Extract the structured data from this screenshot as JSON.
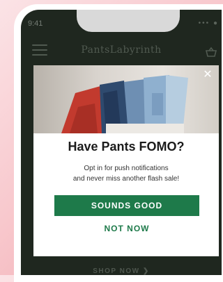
{
  "status_bar": {
    "time": "9:41",
    "icons": "••• ●"
  },
  "nav": {
    "brand": "PantsLabyrinth"
  },
  "background": {
    "shop_link": "SHOP NOW ❯"
  },
  "modal": {
    "close_glyph": "✕",
    "title": "Have Pants FOMO?",
    "body_line1": "Opt in for push notifications",
    "body_line2": "and never miss another flash sale!",
    "primary_label": "SOUNDS GOOD",
    "secondary_label": "NOT NOW"
  },
  "colors": {
    "accent_green": "#1e7a4a",
    "screen_bg": "#252e25",
    "page_bg": "#f8c8cd"
  },
  "icons": [
    "menu-icon",
    "cart-icon",
    "close-icon",
    "signal-icon",
    "battery-icon"
  ]
}
